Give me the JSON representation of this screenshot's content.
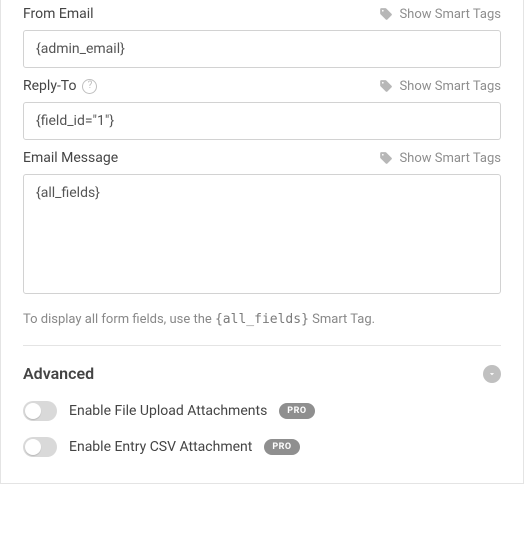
{
  "fields": {
    "fromEmail": {
      "label": "From Email",
      "value": "{admin_email}"
    },
    "replyTo": {
      "label": "Reply-To",
      "value": "{field_id=\"1\"}"
    },
    "message": {
      "label": "Email Message",
      "value": "{all_fields}"
    }
  },
  "smartTagsLabel": "Show Smart Tags",
  "hint": {
    "pre": "To display all form fields, use the ",
    "tag": "{all_fields}",
    "post": " Smart Tag."
  },
  "advanced": {
    "title": "Advanced",
    "proLabel": "PRO",
    "options": {
      "fileUpload": "Enable File Upload Attachments",
      "entryCsv": "Enable Entry CSV Attachment"
    }
  }
}
